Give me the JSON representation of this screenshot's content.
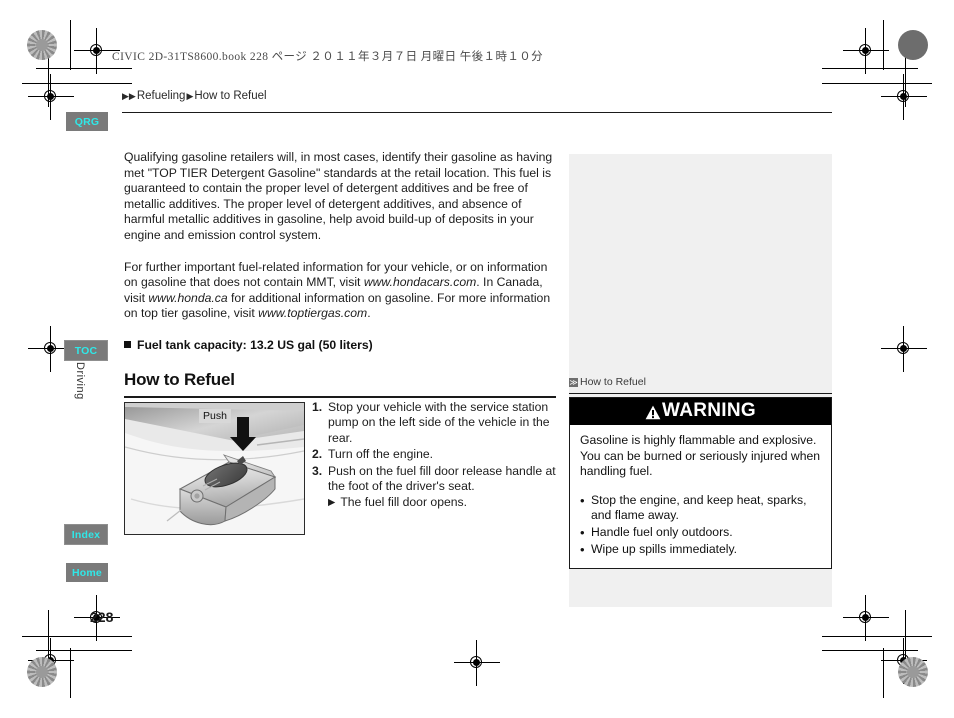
{
  "print_slug": "CIVIC 2D-31TS8600.book   228 ページ   ２０１１年３月７日   月曜日   午後１時１０分",
  "breadcrumb": {
    "arrow1": "▶",
    "arrow2": "▶",
    "level1": "Refueling",
    "arrow3": "▶",
    "level2": "How to Refuel"
  },
  "nav": {
    "tabs": [
      {
        "label": "QRG"
      },
      {
        "label": "TOC"
      },
      {
        "label": "Index"
      },
      {
        "label": "Home"
      }
    ],
    "section_label": "Driving"
  },
  "content": {
    "paragraph1": "Qualifying gasoline retailers will, in most cases, identify their gasoline as having met \"TOP TIER Detergent Gasoline\" standards at the retail location. This fuel is guaranteed to contain the proper level of detergent additives and be free of metallic additives. The proper level of detergent additives, and absence of harmful metallic additives in gasoline, help avoid build-up of deposits in your engine and emission control system.",
    "paragraph2": {
      "part1": "For further important fuel-related information for your vehicle, or on information on gasoline that does not contain MMT, visit ",
      "url1": "www.hondacars.com",
      "part2": ". In Canada, visit ",
      "url2": "www.honda.ca",
      "part3": " for additional information on gasoline. For more information on top tier gasoline, visit ",
      "url3": "www.toptiergas.com",
      "part4": "."
    },
    "spec": "Fuel tank capacity: 13.2 US gal (50 liters)",
    "section_heading": "How to Refuel",
    "illustration": {
      "push_label": "Push"
    },
    "steps": [
      {
        "num": "1.",
        "text": "Stop your vehicle with the service station pump on the left side of the vehicle in the rear."
      },
      {
        "num": "2.",
        "text": "Turn off the engine."
      },
      {
        "num": "3.",
        "text": "Push on the fuel fill door release handle at the foot of the driver's seat."
      }
    ],
    "substep": {
      "arrow": "▶",
      "text": "The fuel fill door opens."
    }
  },
  "sidebar": {
    "reference_icon": "≫",
    "reference_label": "How to Refuel",
    "warning": {
      "title": "WARNING",
      "intro": "Gasoline is highly flammable and explosive. You can be burned or seriously injured when handling fuel.",
      "bullet_char": "•",
      "items": [
        "Stop the engine, and keep heat, sparks, and flame away.",
        "Handle fuel only outdoors.",
        "Wipe up spills immediately."
      ]
    }
  },
  "page_number": "228",
  "colors": {
    "tab_background": "#7a7a7a",
    "tab_text": "#2fe8e8",
    "sidebar_background": "#f0f0f0",
    "warning_header_background": "#000000",
    "warning_header_text": "#ffffff"
  }
}
